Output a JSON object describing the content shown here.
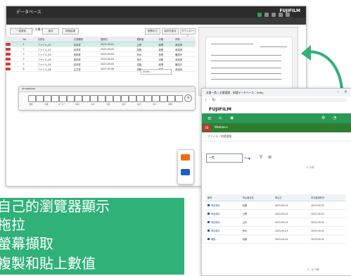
{
  "win1": {
    "title": "データベース",
    "brand": "FUJIFILM",
    "crumb": "台帳検索結果一覧: 文書データベース",
    "buttons": [
      "一括更新",
      "保存",
      "検索結果",
      "帳票出力",
      "保存先設定",
      "ダウンロード"
    ],
    "table_headers": [
      "",
      "No.",
      "文書名",
      "文書種別",
      "登録日",
      "更新者",
      "分類",
      "状態"
    ],
    "rows": [
      {
        "no": "1",
        "name": "ファイル_01",
        "type": "請求書",
        "date": "2023-09-01",
        "user": "山田",
        "cat": "経理",
        "state": "承認済"
      },
      {
        "no": "2",
        "name": "ファイル_02",
        "type": "請求書",
        "date": "2023-09-02",
        "user": "佐藤",
        "cat": "経理",
        "state": "承認済"
      },
      {
        "no": "3",
        "name": "ファイル_03",
        "type": "見積書",
        "date": "2023-09-03",
        "user": "鈴木",
        "cat": "営業",
        "state": "確認中"
      },
      {
        "no": "4",
        "name": "ファイル_04",
        "type": "契約書",
        "date": "2023-09-04",
        "user": "田中",
        "cat": "法務",
        "state": "承認済"
      },
      {
        "no": "5",
        "name": "ファイル_05",
        "type": "請求書",
        "date": "2023-09-05",
        "user": "高橋",
        "cat": "経理",
        "state": "確認中"
      },
      {
        "no": "6",
        "name": "ファイル_06",
        "type": "注文書",
        "date": "2023-09-06",
        "user": "伊藤",
        "cat": "購買",
        "state": "承認済"
      }
    ],
    "palette_title": "Annotation",
    "palette_tools": [
      "選択",
      "テキスト",
      "付箋",
      "スタンプ",
      "マーカー",
      "矩形",
      "楕円",
      "直線",
      "矢印",
      "手書き",
      "消去",
      "コピー",
      "貼付",
      "回転",
      "拡大",
      "縮小",
      "前へ",
      "次へ",
      "印刷",
      "設定",
      "保存"
    ],
    "dropdown": "200%"
  },
  "win2": {
    "title": "文書一覧 | 文書管理 - 申請データベース - Softy",
    "brand": "FUJIFILM",
    "tab": "Webdocs",
    "crumb": "ファイル / 申請書類",
    "filter_value": "一覧",
    "count": "1 / 1件",
    "count2": "1 - 5 / 5件",
    "headers": [
      "番号",
      "申込者氏名",
      "申込日",
      "申請者契約日"
    ],
    "rows": [
      {
        "id": "申請済み",
        "name": "佐藤",
        "date": "2023-09-24",
        "end": "2023-09-31"
      },
      {
        "id": "申請済み",
        "name": "小野",
        "date": "2023-09-23",
        "end": "2023-09-31"
      },
      {
        "id": "申請済み",
        "name": "山中",
        "date": "2023-09-23",
        "end": "2023-09-31"
      },
      {
        "id": "申請済み",
        "name": "鈴木",
        "date": "2023-09-23",
        "end": "2023-09-31"
      },
      {
        "id": "確認...",
        "name": "高橋",
        "date": "2023-09-24",
        "end": "2023-09-31"
      }
    ]
  },
  "callout": {
    "lines": [
      "自己的瀏覽器顯示",
      "拖拉",
      "螢幕擷取",
      "複製和貼上數值"
    ]
  },
  "colors": {
    "accent_green": "#2fb178",
    "brand_green": "#2a9a55",
    "pdf_red": "#d63a3a"
  }
}
